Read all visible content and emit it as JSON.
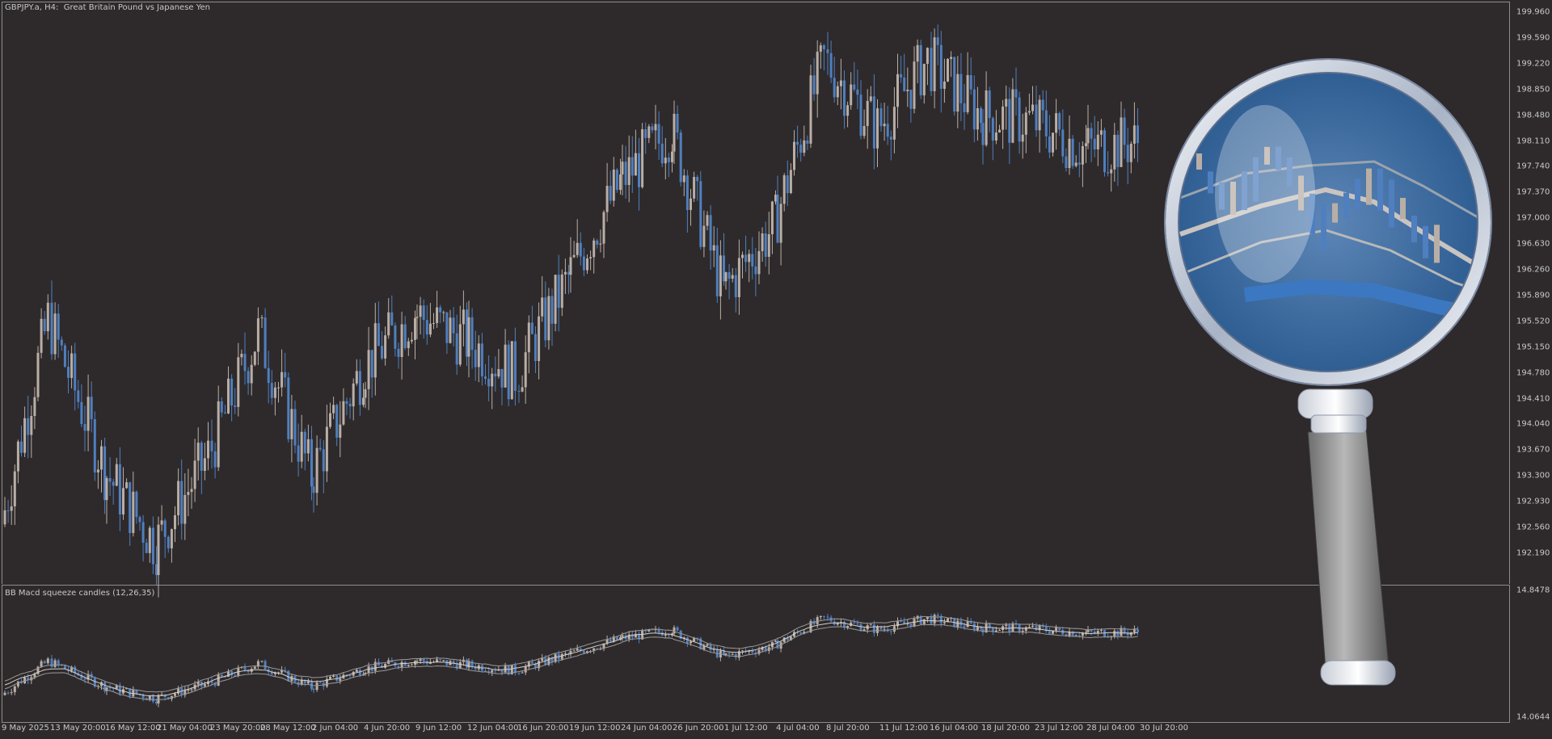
{
  "main_pane": {
    "title": "GBPJPY.a, H4:  Great Britain Pound vs Japanese Yen",
    "price_axis": [
      "199.960",
      "199.590",
      "199.220",
      "198.850",
      "198.480",
      "198.110",
      "197.740",
      "197.370",
      "197.000",
      "196.630",
      "196.260",
      "195.890",
      "195.520",
      "195.150",
      "194.780",
      "194.410",
      "194.040",
      "193.670",
      "193.300",
      "192.930",
      "192.560",
      "192.190"
    ]
  },
  "sub_pane": {
    "title": "BB Macd squeeze candles (12,26,35)",
    "axis": [
      "14.8478",
      "14.0644"
    ]
  },
  "time_axis": [
    "9 May 2025",
    "13 May 20:00",
    "16 May 12:00",
    "21 May 04:00",
    "23 May 20:00",
    "28 May 12:00",
    "2 Jun 04:00",
    "4 Jun 20:00",
    "9 Jun 12:00",
    "12 Jun 04:00",
    "16 Jun 20:00",
    "19 Jun 12:00",
    "24 Jun 04:00",
    "26 Jun 20:00",
    "1 Jul 12:00",
    "4 Jul 04:00",
    "8 Jul 20:00",
    "11 Jul 12:00",
    "16 Jul 04:00",
    "18 Jul 20:00",
    "23 Jul 12:00",
    "28 Jul 04:00",
    "30 Jul 20:00"
  ],
  "colors": {
    "background": "#2e2a2b",
    "bull_candle": "#b9aea6",
    "bear_candle": "#4f7fbf",
    "grid_frame": "#8c8c8c",
    "text": "#c8c8c8"
  },
  "overlay": {
    "icon": "magnifying-glass"
  },
  "chart_data": {
    "type": "candlestick",
    "symbol": "GBPJPY.a",
    "timeframe": "H4",
    "ylim": [
      192.0,
      200.1
    ],
    "close_path": [
      {
        "x": "9 May 2025",
        "y": 192.6
      },
      {
        "x": "13 May 20:00",
        "y": 195.6
      },
      {
        "x": "16 May 12:00",
        "y": 193.4
      },
      {
        "x": "21 May 04:00",
        "y": 192.3
      },
      {
        "x": "23 May 20:00",
        "y": 193.6
      },
      {
        "x": "28 May 12:00",
        "y": 195.4
      },
      {
        "x": "2 Jun 04:00",
        "y": 193.3
      },
      {
        "x": "4 Jun 20:00",
        "y": 194.9
      },
      {
        "x": "9 Jun 12:00",
        "y": 195.7
      },
      {
        "x": "12 Jun 04:00",
        "y": 195.3
      },
      {
        "x": "16 Jun 20:00",
        "y": 194.8
      },
      {
        "x": "19 Jun 12:00",
        "y": 196.2
      },
      {
        "x": "24 Jun 04:00",
        "y": 197.6
      },
      {
        "x": "26 Jun 20:00",
        "y": 198.4
      },
      {
        "x": "1 Jul 12:00",
        "y": 196.0
      },
      {
        "x": "4 Jul 04:00",
        "y": 197.0
      },
      {
        "x": "8 Jul 20:00",
        "y": 199.4
      },
      {
        "x": "11 Jul 12:00",
        "y": 198.4
      },
      {
        "x": "16 Jul 04:00",
        "y": 199.4
      },
      {
        "x": "18 Jul 20:00",
        "y": 198.6
      },
      {
        "x": "23 Jul 12:00",
        "y": 198.5
      },
      {
        "x": "28 Jul 04:00",
        "y": 198.1
      },
      {
        "x": "30 Jul 20:00",
        "y": 198.2
      }
    ]
  }
}
